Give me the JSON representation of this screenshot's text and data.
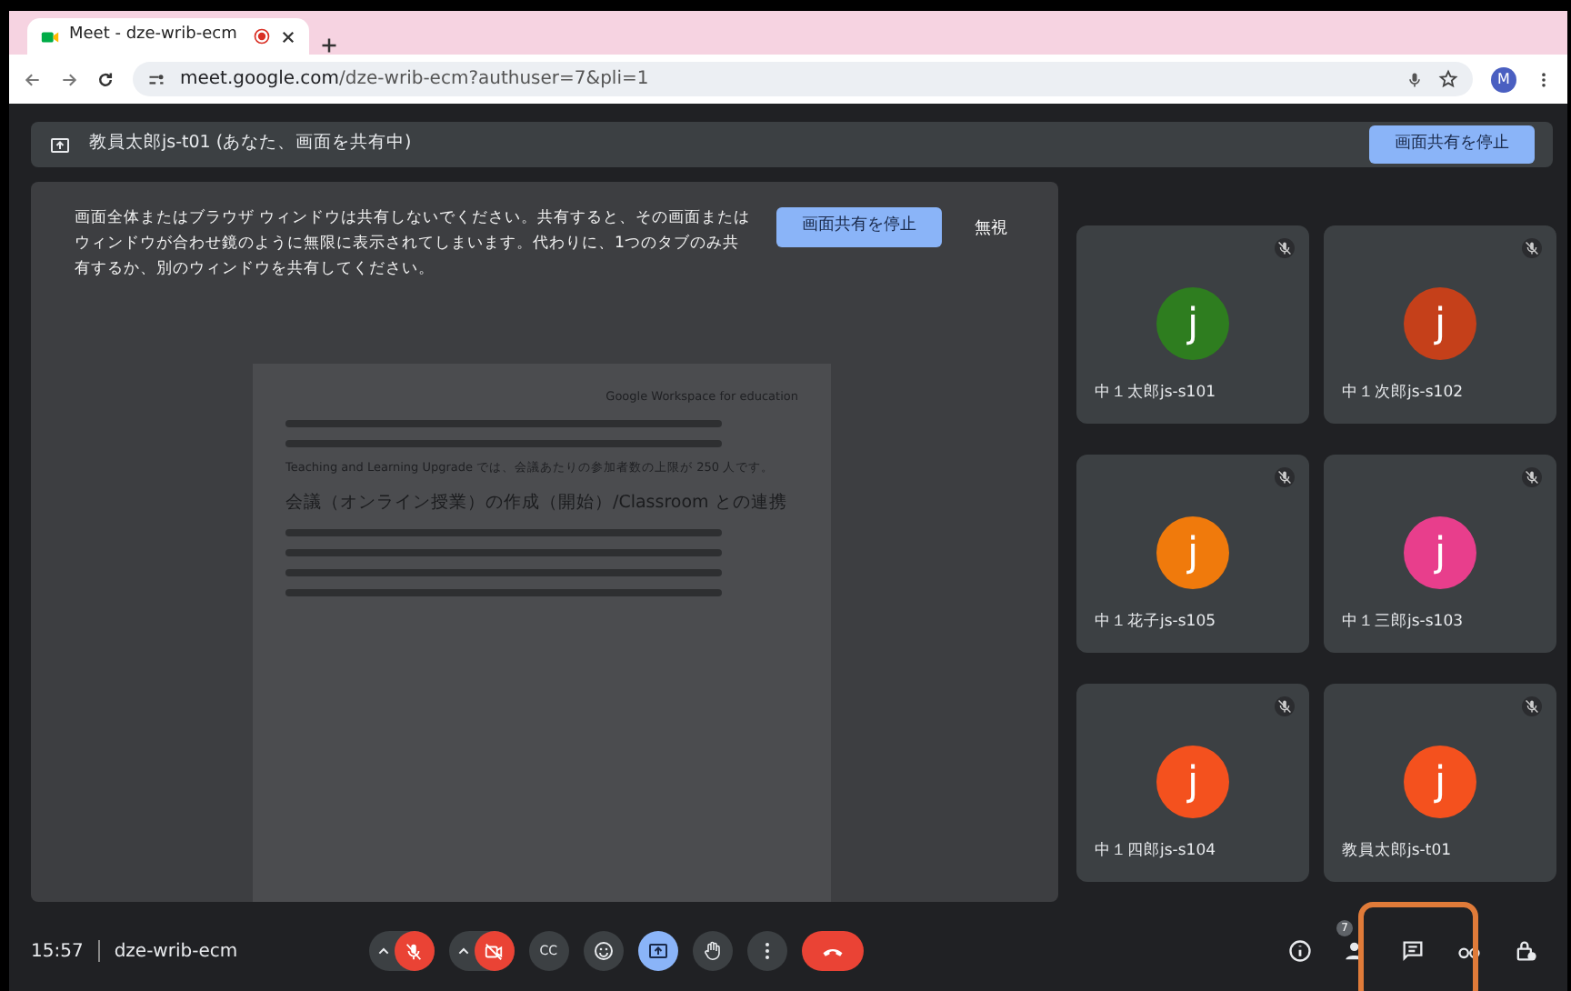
{
  "browser": {
    "tab_title": "Meet - dze-wrib-ecm",
    "url_host": "meet.google.com",
    "url_path": "/dze-wrib-ecm?authuser=7&pli=1",
    "avatar_letter": "M"
  },
  "banner": {
    "text": "教員太郎js-t01 (あなた、画面を共有中)",
    "button": "画面共有を停止"
  },
  "warning": {
    "text": "画面全体またはブラウザ ウィンドウは共有しないでください。共有すると、その画面またはウィンドウが合わせ鏡のように無限に表示されてしまいます。代わりに、1つのタブのみ共有するか、別のウィンドウを共有してください。",
    "stop_button": "画面共有を停止",
    "dismiss_button": "無視"
  },
  "shared_document": {
    "lines": [
      {
        "kind": "right",
        "text": "Google Workspace for education"
      },
      {
        "kind": "bar"
      },
      {
        "kind": "bar"
      },
      {
        "kind": "text",
        "text": "Teaching and Learning Upgrade では、会議あたりの参加者数の上限が 250 人です。"
      },
      {
        "kind": "heading",
        "text": "会議（オンライン授業）の作成（開始）/Classroom との連携"
      },
      {
        "kind": "bar"
      },
      {
        "kind": "bar"
      },
      {
        "kind": "bar"
      },
      {
        "kind": "bar"
      }
    ]
  },
  "participants": [
    {
      "name": "中１太郎js-s101",
      "initial": "j",
      "color": "#2e7d1f",
      "muted": true
    },
    {
      "name": "中１次郎js-s102",
      "initial": "j",
      "color": "#c5401a",
      "muted": true
    },
    {
      "name": "中１花子js-s105",
      "initial": "j",
      "color": "#f07a0c",
      "muted": true
    },
    {
      "name": "中１三郎js-s103",
      "initial": "j",
      "color": "#e83e8c",
      "muted": true
    },
    {
      "name": "中１四郎js-s104",
      "initial": "j",
      "color": "#f4511e",
      "muted": true
    },
    {
      "name": "教員太郎js-t01",
      "initial": "j",
      "color": "#f4511e",
      "muted": true
    }
  ],
  "controls": {
    "time": "15:57",
    "meeting_code": "dze-wrib-ecm",
    "mic_on": false,
    "camera_on": false,
    "captions": "CC",
    "presenting": true,
    "people_count": "7",
    "chat_highlighted": true
  }
}
